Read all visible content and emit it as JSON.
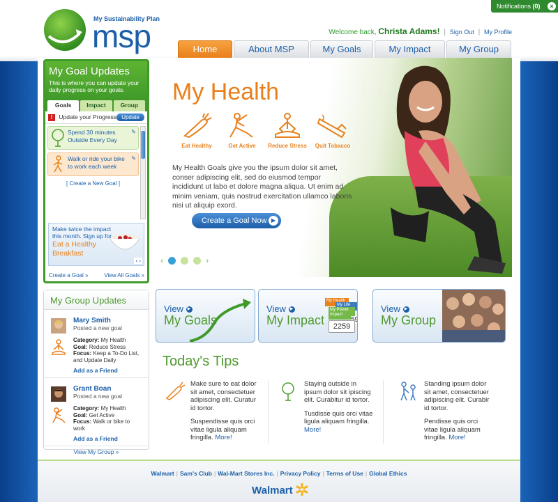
{
  "notifications": {
    "label": "Notifications",
    "count": "(0)",
    "close": "×"
  },
  "logo": {
    "tagline": "My Sustainability Plan",
    "wordmark": "msp"
  },
  "header": {
    "welcome": "Welcome back,",
    "user_name": "Christa Adams",
    "bang": "!",
    "sign_out": "Sign Out",
    "separator": "|",
    "my_profile": "My Profile"
  },
  "nav": {
    "tabs": [
      {
        "label": "Home"
      },
      {
        "label": "About MSP"
      },
      {
        "label": "My Goals"
      },
      {
        "label": "My Impact"
      },
      {
        "label": "My Group"
      }
    ]
  },
  "goal_panel": {
    "title": "My Goal Updates",
    "subtitle": "This is where you can update your daily progress on your goals.",
    "tabs": [
      {
        "label": "Goals"
      },
      {
        "label": "Impact"
      },
      {
        "label": "Group"
      }
    ],
    "update_progress_label": "Update your Progress",
    "update_button": "Update",
    "goals": [
      {
        "line1": "Spend 30 minutes",
        "line2": "Outside Every Day"
      },
      {
        "line1": "Walk or ride your bike",
        "line2": "to work each week"
      }
    ],
    "new_goal": "[ Create a New Goal ]",
    "promo": {
      "line1": "Make twice the impact",
      "line2": "this month. Sign up for",
      "line3": "Eat a Healthy",
      "line4": "Breakfast",
      "nav": "‹ ›"
    },
    "create_link": "Create a Goal »",
    "view_all_link": "View All Goals »"
  },
  "hero": {
    "title": "My Health",
    "icons": [
      {
        "label": "Eat Healthy",
        "icon": "carrot-icon"
      },
      {
        "label": "Get Active",
        "icon": "stretch-icon"
      },
      {
        "label": "Reduce Stress",
        "icon": "meditate-icon"
      },
      {
        "label": "Quit Tobacco",
        "icon": "no-smoking-icon"
      }
    ],
    "body": "My Health Goals give you the ipsum dolor sit amet, conser adipiscing elit, sed do eiusmod tempor incididunt ut labo et dolore magna aliqua. Ut enim ad minim veniam, quis nostrud exercitation ullamco laboris nisi ut aliquip exord.",
    "cta": "Create a Goal Now",
    "cta_arrow": "▶",
    "carousel": {
      "prev": "‹",
      "next": "›"
    }
  },
  "group_updates": {
    "title": "My Group Updates",
    "items": [
      {
        "name": "Mary Smith",
        "action": "Posted a new goal",
        "category_label": "Category:",
        "category": "My Health",
        "goal_label": "Goal:",
        "goal": "Reduce Stress",
        "focus_label": "Focus:",
        "focus": "Keep a To-Do List, and Update Daily",
        "add_friend": "Add as a Friend"
      },
      {
        "name": "Grant Boan",
        "action": "Posted a new goal",
        "category_label": "Category:",
        "category": "My Health",
        "goal_label": "Goal:",
        "goal": "Get Active",
        "focus_label": "Focus:",
        "focus": "Walk or bike to work",
        "add_friend": "Add as a Friend"
      }
    ],
    "view_group": "View My Group »"
  },
  "cards": [
    {
      "view": "View",
      "label": "My Goals",
      "arrow": "▶"
    },
    {
      "view": "View",
      "label": "My Impact",
      "arrow": "▶",
      "badge_health": "My Health",
      "badge_life": "My Life",
      "badge_planet": "My Planet",
      "badge_planet_sub": "Impact",
      "counter": "2259",
      "partial": "59"
    },
    {
      "view": "View",
      "label": "My Group",
      "arrow": "▶"
    }
  ],
  "tips": {
    "title": "Today's Tips",
    "items": [
      {
        "p1": "Make sure to eat dolor sit amet, consectetuer adipiscing elit. Curatur id tortor.",
        "p2": "Suspendisse quis orci vitae ligula aliquam fringilla.",
        "more": "More!",
        "icon": "carrot-icon"
      },
      {
        "p1": "Staying outside in ipsum dolor sit ipiscing elit. Curabitur id tortor.",
        "p2": "Tusdisse quis orci vitae ligula aliquam fringilla.",
        "more": "More!",
        "icon": "tree-icon"
      },
      {
        "p1": "Standing ipsum dolor sit amet, consectetuer adipiscing elit. Curabir id tortor.",
        "p2": "Pendisse quis orci vitae ligula aliquam fringilla.",
        "more": "More!",
        "icon": "family-icon"
      }
    ]
  },
  "footer": {
    "links": [
      "Walmart",
      "Sam's Club",
      "Wal-Mart Stores Inc.",
      "Privacy Policy",
      "Terms of Use",
      "Global Ethics"
    ],
    "separator": "|",
    "brand": "Walmart"
  },
  "colors": {
    "green": "#3f9a2a",
    "orange": "#e8801c",
    "blue": "#1c5fa8"
  }
}
